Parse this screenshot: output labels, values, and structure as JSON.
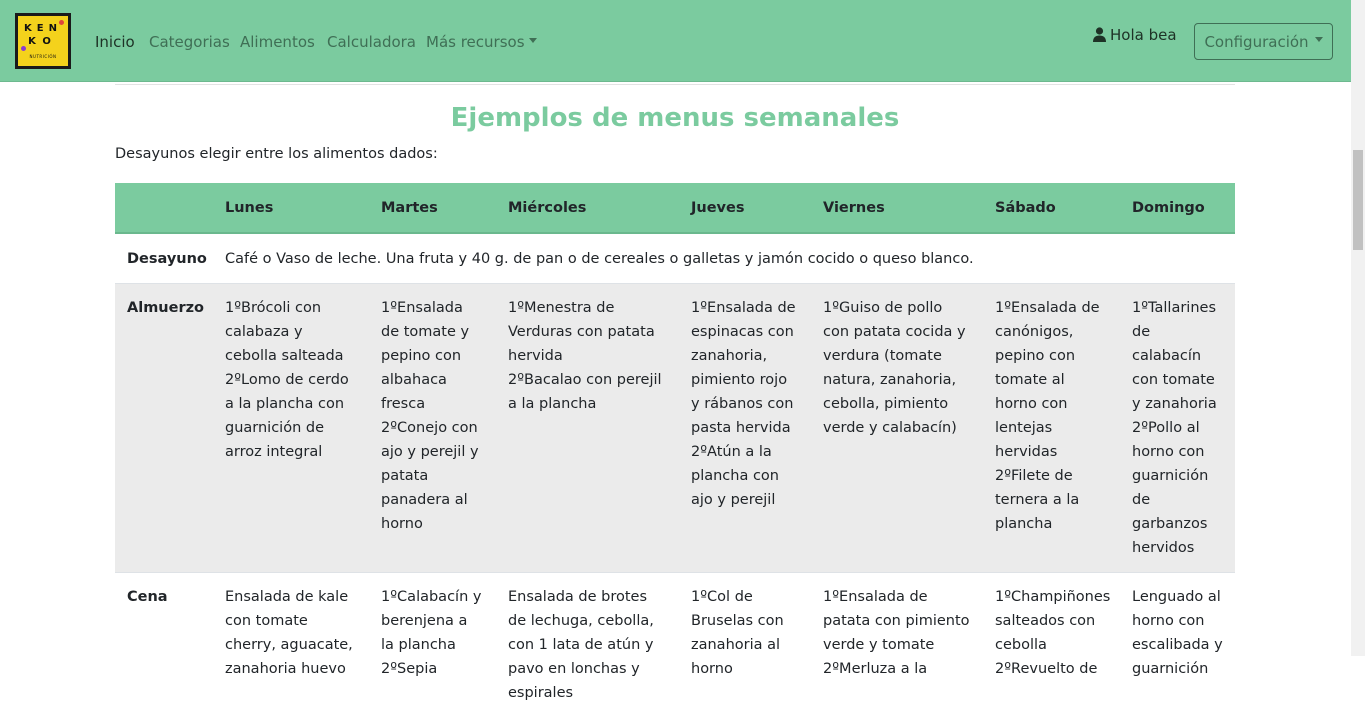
{
  "navbar": {
    "logo": {
      "line1": "KEN",
      "line2": "KO",
      "tagline": "NUTRICIÓN"
    },
    "links": [
      {
        "label": "Inicio",
        "active": true
      },
      {
        "label": "Categorias"
      },
      {
        "label": "Alimentos"
      },
      {
        "label": "Calculadora"
      },
      {
        "label": "Más recursos",
        "dropdown": true
      }
    ],
    "user_greeting": "Hola bea",
    "config_label": "Configuración",
    "colors": {
      "bar": "#7bcb9f",
      "logo": "#f4d21c"
    }
  },
  "page": {
    "title": "Ejemplos de menus semanales",
    "intro": "Desayunos elegir entre los alimentos dados:"
  },
  "table": {
    "days": [
      "Lunes",
      "Martes",
      "Miércoles",
      "Jueves",
      "Viernes",
      "Sábado",
      "Domingo"
    ],
    "breakfast": {
      "label": "Desayuno",
      "text": "Café o Vaso de leche. Una fruta y 40 g. de pan o de cereales o galletas y jamón cocido o queso blanco."
    },
    "lunch": {
      "label": "Almuerzo",
      "cells": [
        [
          "1ºBrócoli con calabaza y cebolla salteada",
          "2ºLomo de cerdo a la plancha con guarnición de arroz integral"
        ],
        [
          "1ºEnsalada de tomate y pepino con albahaca fresca",
          "2ºConejo con ajo y perejil y patata panadera al horno"
        ],
        [
          "1ºMenestra de Verduras con patata hervida",
          "2ºBacalao con perejil a la plancha"
        ],
        [
          "1ºEnsalada de espinacas con zanahoria, pimiento rojo y rábanos con pasta hervida",
          "2ºAtún a la plancha con ajo y perejil"
        ],
        [
          "1ºGuiso de pollo con patata cocida y verdura (tomate natura, zanahoria, cebolla, pimiento verde y calabacín)"
        ],
        [
          "1ºEnsalada de canónigos, pepino con tomate al horno con lentejas hervidas",
          "2ºFilete de ternera a la plancha"
        ],
        [
          "1ºTallarines de calabacín con tomate y zanahoria",
          "2ºPollo al horno con guarnición de garbanzos hervidos"
        ]
      ]
    },
    "dinner": {
      "label": "Cena",
      "cells": [
        [
          "Ensalada de kale con tomate cherry, aguacate, zanahoria huevo"
        ],
        [
          "1ºCalabacín y berenjena a la plancha",
          "2ºSepia"
        ],
        [
          "Ensalada de brotes de lechuga, cebolla, con 1 lata de atún y pavo en lonchas y espirales"
        ],
        [
          "1ºCol de Bruselas con zanahoria al horno"
        ],
        [
          "1ºEnsalada de patata con pimiento verde y tomate",
          "2ºMerluza a la"
        ],
        [
          "1ºChampiñones salteados con cebolla",
          "2ºRevuelto de"
        ],
        [
          "Lenguado al horno con escalibada y guarnición"
        ]
      ]
    }
  }
}
